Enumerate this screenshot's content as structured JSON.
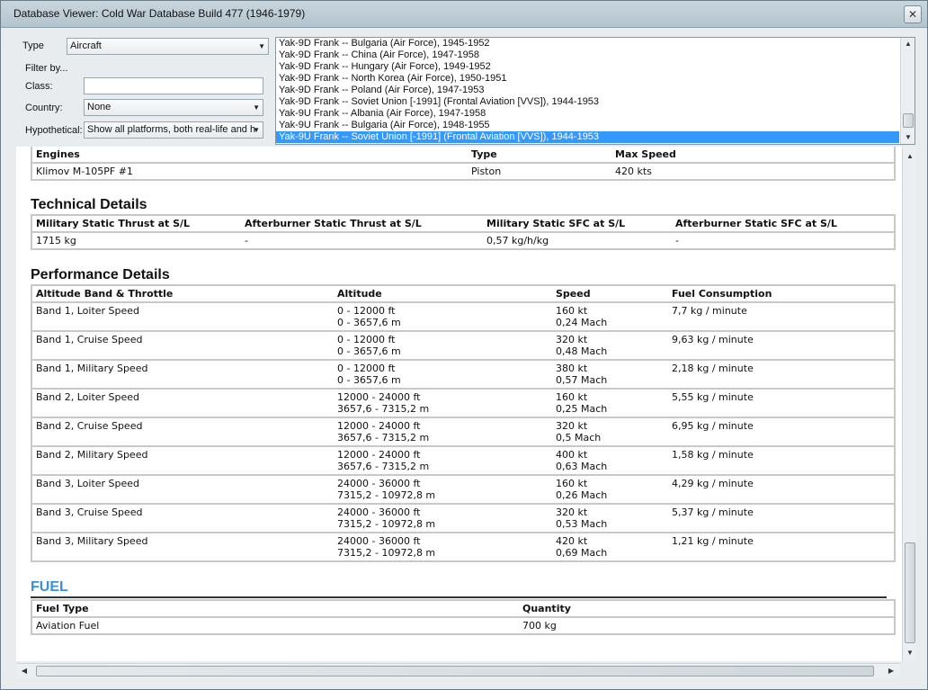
{
  "window": {
    "title": "Database Viewer: Cold War Database Build 477 (1946-1979)",
    "close_label": "✕"
  },
  "filters": {
    "type_label": "Type",
    "type_value": "Aircraft",
    "filter_by_label": "Filter by...",
    "class_label": "Class:",
    "class_value": "",
    "country_label": "Country:",
    "country_value": "None",
    "hypothetical_label": "Hypothetical:",
    "hypothetical_value": "Show all platforms, both real-life and h"
  },
  "platform_list": [
    "Yak-9D Frank -- Bulgaria (Air Force), 1945-1952",
    "Yak-9D Frank -- China (Air Force), 1947-1958",
    "Yak-9D Frank -- Hungary (Air Force), 1949-1952",
    "Yak-9D Frank -- North Korea (Air Force), 1950-1951",
    "Yak-9D Frank -- Poland (Air Force), 1947-1953",
    "Yak-9D Frank -- Soviet Union [-1991] (Frontal Aviation [VVS]), 1944-1953",
    "Yak-9U Frank -- Albania (Air Force), 1947-1958",
    "Yak-9U Frank -- Bulgaria (Air Force), 1948-1955",
    "Yak-9U Frank -- Soviet Union [-1991] (Frontal Aviation [VVS]), 1944-1953"
  ],
  "engines": {
    "headers": [
      "Engines",
      "Type",
      "Max Speed"
    ],
    "rows": [
      [
        "Klimov M-105PF #1",
        "Piston",
        "420 kts"
      ]
    ]
  },
  "technical": {
    "title": "Technical Details",
    "headers": [
      "Military Static Thrust at S/L",
      "Afterburner Static Thrust at S/L",
      "Military Static SFC at S/L",
      "Afterburner Static SFC at S/L"
    ],
    "rows": [
      [
        "1715 kg",
        "-",
        "0,57 kg/h/kg",
        "-"
      ]
    ]
  },
  "performance": {
    "title": "Performance Details",
    "headers": [
      "Altitude Band & Throttle",
      "Altitude",
      "Speed",
      "Fuel Consumption"
    ],
    "rows": [
      [
        "Band 1, Loiter Speed",
        "0 - 12000 ft",
        "0 - 3657,6 m",
        "160 kt",
        "0,24 Mach",
        "7,7 kg / minute"
      ],
      [
        "Band 1, Cruise Speed",
        "0 - 12000 ft",
        "0 - 3657,6 m",
        "320 kt",
        "0,48 Mach",
        "9,63 kg / minute"
      ],
      [
        "Band 1, Military Speed",
        "0 - 12000 ft",
        "0 - 3657,6 m",
        "380 kt",
        "0,57 Mach",
        "2,18 kg / minute"
      ],
      [
        "Band 2, Loiter Speed",
        "12000 - 24000 ft",
        "3657,6 - 7315,2 m",
        "160 kt",
        "0,25 Mach",
        "5,55 kg / minute"
      ],
      [
        "Band 2, Cruise Speed",
        "12000 - 24000 ft",
        "3657,6 - 7315,2 m",
        "320 kt",
        "0,5 Mach",
        "6,95 kg / minute"
      ],
      [
        "Band 2, Military Speed",
        "12000 - 24000 ft",
        "3657,6 - 7315,2 m",
        "400 kt",
        "0,63 Mach",
        "1,58 kg / minute"
      ],
      [
        "Band 3, Loiter Speed",
        "24000 - 36000 ft",
        "7315,2 - 10972,8 m",
        "160 kt",
        "0,26 Mach",
        "4,29 kg / minute"
      ],
      [
        "Band 3, Cruise Speed",
        "24000 - 36000 ft",
        "7315,2 - 10972,8 m",
        "320 kt",
        "0,53 Mach",
        "5,37 kg / minute"
      ],
      [
        "Band 3, Military Speed",
        "24000 - 36000 ft",
        "7315,2 - 10972,8 m",
        "420 kt",
        "0,69 Mach",
        "1,21 kg / minute"
      ]
    ]
  },
  "fuel": {
    "title": "FUEL",
    "headers": [
      "Fuel Type",
      "Quantity"
    ],
    "rows": [
      [
        "Aviation Fuel",
        "700 kg"
      ]
    ]
  },
  "icons": {
    "dropdown": "chevron-down-icon",
    "close": "close-icon"
  }
}
